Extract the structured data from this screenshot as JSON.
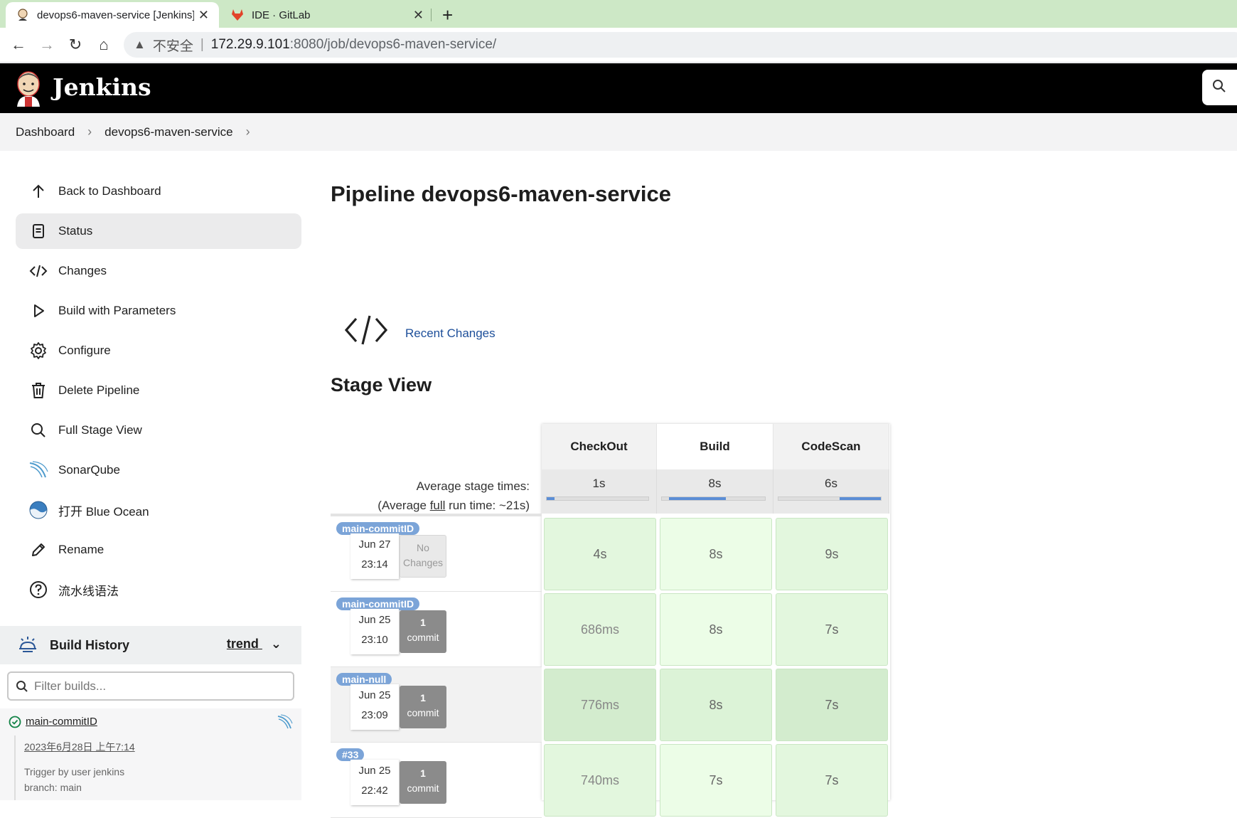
{
  "browser": {
    "tabs": [
      {
        "title": "devops6-maven-service [Jenkins]",
        "active": true
      },
      {
        "title": "IDE · GitLab",
        "active": false
      }
    ],
    "url_warning": "不安全",
    "url_host": "172.29.9.101",
    "url_path": ":8080/job/devops6-maven-service/"
  },
  "header": {
    "title": "Jenkins"
  },
  "breadcrumb": [
    "Dashboard",
    "devops6-maven-service"
  ],
  "sidebar": {
    "items": [
      {
        "label": "Back to Dashboard",
        "icon": "arrow-up-icon"
      },
      {
        "label": "Status",
        "icon": "document-icon",
        "active": true
      },
      {
        "label": "Changes",
        "icon": "code-icon"
      },
      {
        "label": "Build with Parameters",
        "icon": "play-icon"
      },
      {
        "label": "Configure",
        "icon": "gear-icon"
      },
      {
        "label": "Delete Pipeline",
        "icon": "trash-icon"
      },
      {
        "label": "Full Stage View",
        "icon": "search-icon"
      },
      {
        "label": "SonarQube",
        "icon": "sonarqube-icon"
      },
      {
        "label": "打开 Blue Ocean",
        "icon": "blue-ocean-icon"
      },
      {
        "label": "Rename",
        "icon": "pencil-icon"
      },
      {
        "label": "流水线语法",
        "icon": "help-icon"
      }
    ]
  },
  "build_history": {
    "title": "Build History",
    "trend": "trend",
    "filter_placeholder": "Filter builds...",
    "entry": {
      "name": "main-commitID",
      "date": "2023年6月28日 上午7:14",
      "trigger": "Trigger by user jenkins",
      "branch": "branch: main"
    }
  },
  "main": {
    "title": "Pipeline devops6-maven-service",
    "recent_changes": "Recent Changes",
    "stage_view_title": "Stage View",
    "avg_label_1": "Average stage times:",
    "avg_label_2a": "(Average ",
    "avg_label_2b": "full",
    "avg_label_2c": " run time: ~21s)",
    "stages": [
      {
        "name": "CheckOut",
        "avg": "1s",
        "bar_start": 0.0,
        "bar_fill": 0.08
      },
      {
        "name": "Build",
        "avg": "8s",
        "bar_start": 0.07,
        "bar_fill": 0.55
      },
      {
        "name": "CodeScan",
        "avg": "6s",
        "bar_start": 0.6,
        "bar_fill": 0.4
      }
    ],
    "runs": [
      {
        "tag": "main-commitID",
        "date": "Jun 27",
        "time": "23:14",
        "change_a": "No",
        "change_b": "Changes",
        "has_commit": false,
        "times": [
          "4s",
          "8s",
          "9s"
        ]
      },
      {
        "tag": "main-commitID",
        "date": "Jun 25",
        "time": "23:10",
        "change_a": "1",
        "change_b": "commit",
        "has_commit": true,
        "times": [
          "686ms",
          "8s",
          "7s"
        ]
      },
      {
        "tag": "main-null",
        "date": "Jun 25",
        "time": "23:09",
        "change_a": "1",
        "change_b": "commit",
        "has_commit": true,
        "times": [
          "776ms",
          "8s",
          "7s"
        ]
      },
      {
        "tag": "#33",
        "date": "Jun 25",
        "time": "22:42",
        "change_a": "1",
        "change_b": "commit",
        "has_commit": true,
        "times": [
          "740ms",
          "7s",
          "7s"
        ]
      }
    ]
  },
  "colors": {
    "cell_green": "#e3f7de",
    "cell_green_light": "#ecfde7",
    "cell_green_hover": "#d3ecce",
    "header_bg": "#000000",
    "tab_bg": "#cde8c6",
    "link": "#1d4f9a"
  }
}
